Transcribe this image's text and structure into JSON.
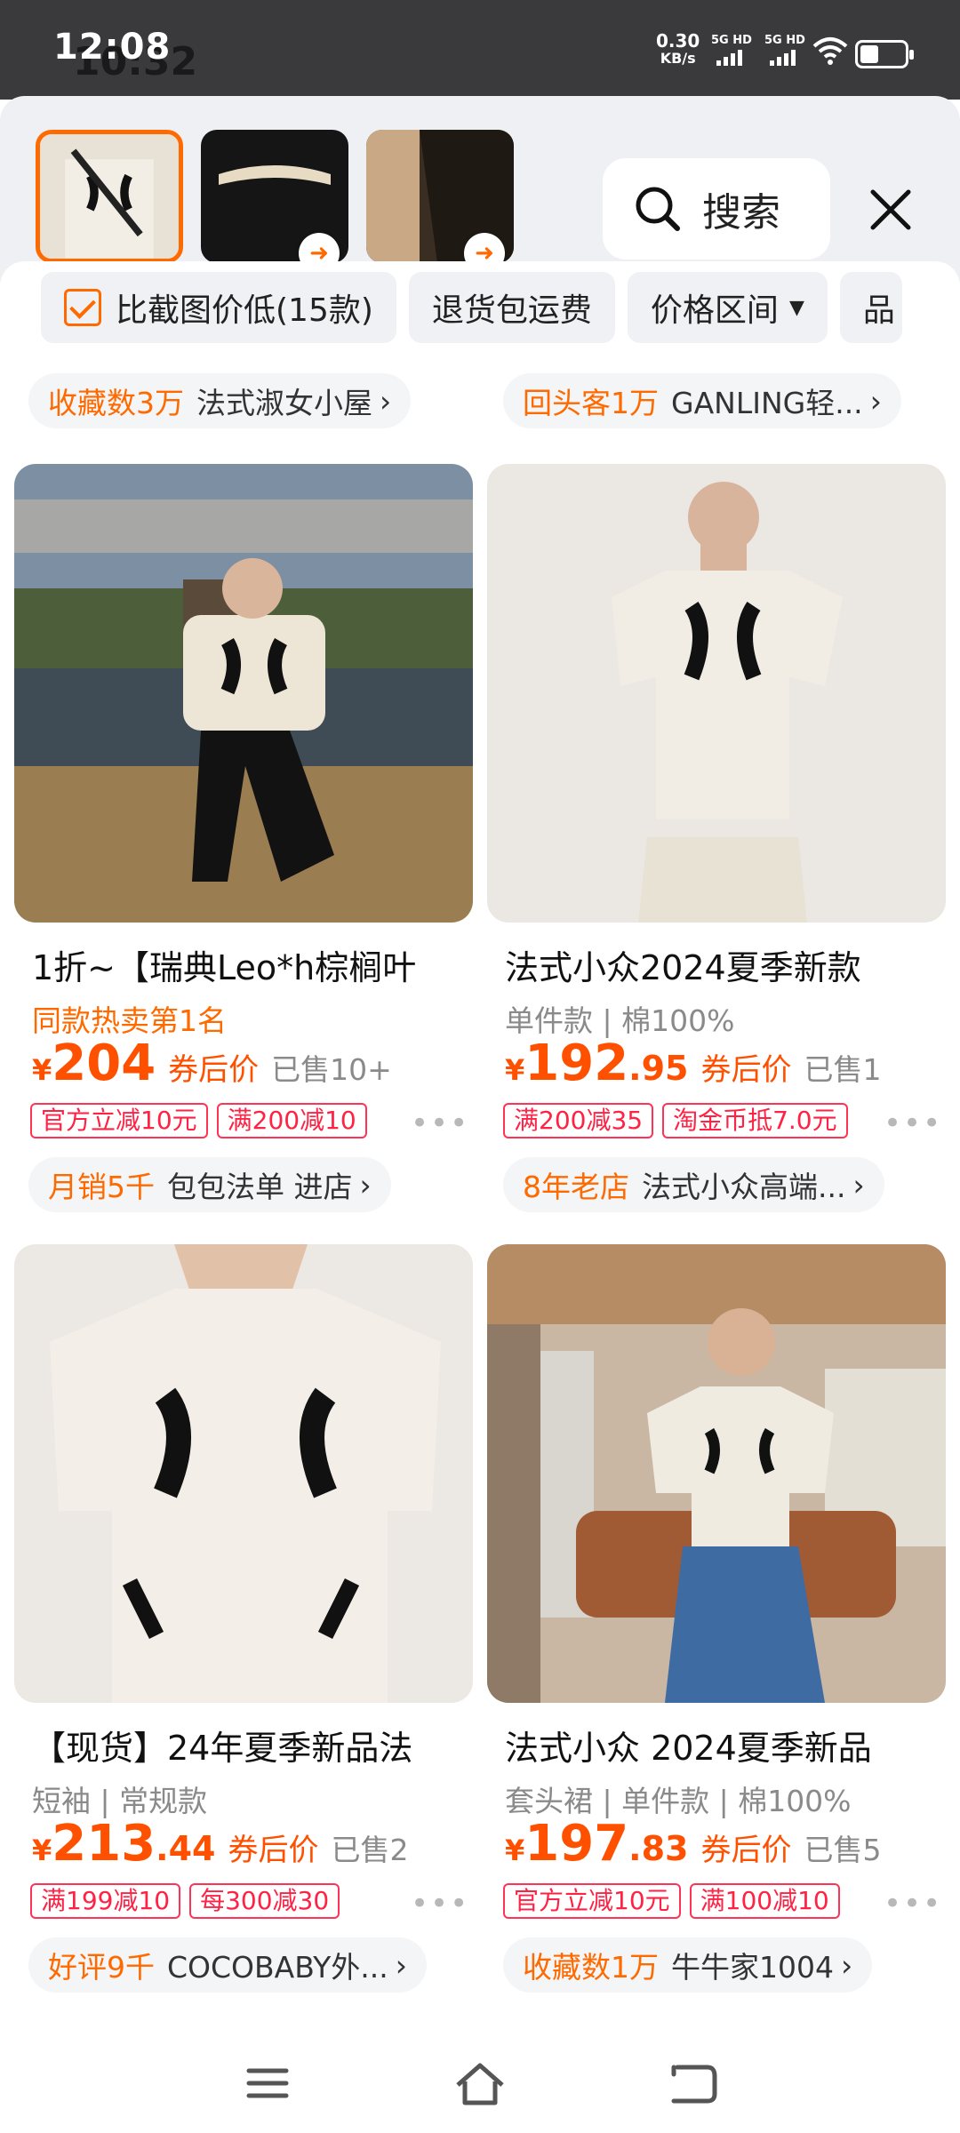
{
  "status_bar": {
    "time": "12:08",
    "ghost_time": "10:32",
    "net_speed": "0.30",
    "net_unit": "KB/s",
    "sim1": "5G HD",
    "sim2": "5G HD"
  },
  "search_panel": {
    "search_label": "搜索"
  },
  "filters": [
    {
      "label": "比截图价低(15款)"
    },
    {
      "label": "退货包运费"
    },
    {
      "label": "价格区间"
    },
    {
      "label": "品"
    }
  ],
  "top_shop_rows": [
    {
      "tag": "收藏数3万",
      "name": "法式淑女小屋"
    },
    {
      "tag": "回头客1万",
      "name": "GANLING轻..."
    }
  ],
  "products": [
    {
      "title": "1折~【瑞典Leo*h棕榈叶",
      "subtitle_hot": "同款热卖第1名",
      "subtitle": "",
      "currency": "¥",
      "price_int": "204",
      "price_dec": "",
      "price_label": "券后价",
      "sold": "已售10+",
      "coupons": [
        "官方立减10元",
        "满200减10"
      ],
      "shop_tag": "月销5千",
      "shop_name": "包包法单 进店"
    },
    {
      "title": "法式小众2024夏季新款",
      "subtitle_hot": "",
      "subtitle": "单件款 | 棉100%",
      "currency": "¥",
      "price_int": "192",
      "price_dec": ".95",
      "price_label": "券后价",
      "sold": "已售1",
      "coupons": [
        "满200减35",
        "淘金币抵7.0元"
      ],
      "shop_tag": "8年老店",
      "shop_name": "法式小众高端..."
    },
    {
      "title": "【现货】24年夏季新品法",
      "subtitle_hot": "",
      "subtitle": "短袖 | 常规款",
      "currency": "¥",
      "price_int": "213",
      "price_dec": ".44",
      "price_label": "券后价",
      "sold": "已售2",
      "coupons": [
        "满199减10",
        "每300减30"
      ],
      "shop_tag": "好评9千",
      "shop_name": "COCOBABY外..."
    },
    {
      "title": "法式小众 2024夏季新品",
      "subtitle_hot": "",
      "subtitle": "套头裙 | 单件款 | 棉100%",
      "currency": "¥",
      "price_int": "197",
      "price_dec": ".83",
      "price_label": "券后价",
      "sold": "已售5",
      "coupons": [
        "官方立减10元",
        "满100减10"
      ],
      "shop_tag": "收藏数1万",
      "shop_name": "牛牛家1004"
    }
  ],
  "more_glyph": "•••",
  "chevron_glyph": "›",
  "colors": {
    "accent": "#ff6a00",
    "price": "#ff5000",
    "coupon": "#ff2244"
  }
}
